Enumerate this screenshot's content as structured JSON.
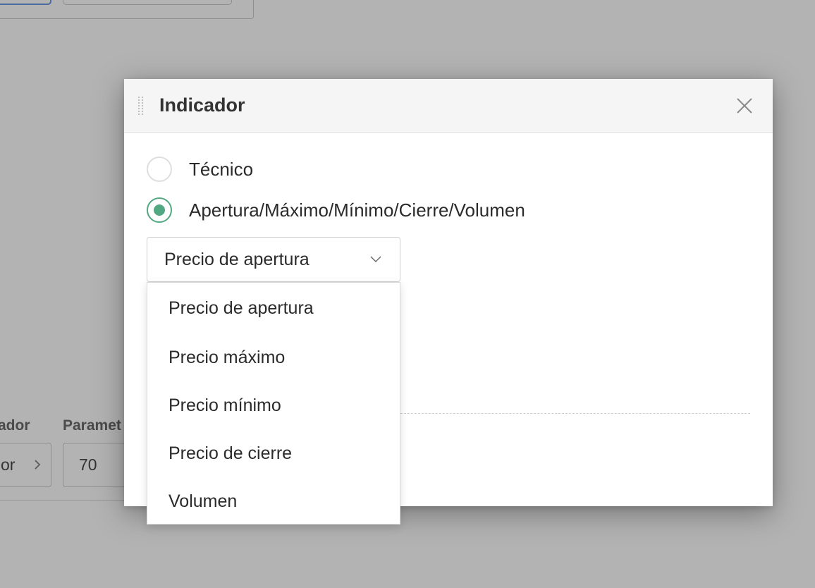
{
  "background": {
    "fields": [
      {
        "label": "ador",
        "value": "or"
      },
      {
        "label": "Paramet",
        "value": "70"
      }
    ]
  },
  "modal": {
    "title": "Indicador",
    "options": [
      {
        "label": "Técnico",
        "checked": false
      },
      {
        "label": "Apertura/Máximo/Mínimo/Cierre/Volumen",
        "checked": true
      }
    ],
    "select": {
      "value": "Precio de apertura",
      "options": [
        "Precio de apertura",
        "Precio máximo",
        "Precio mínimo",
        "Precio de cierre",
        "Volumen"
      ]
    }
  },
  "colors": {
    "accent": "#52a882",
    "overlay": "#b3b3b3"
  }
}
